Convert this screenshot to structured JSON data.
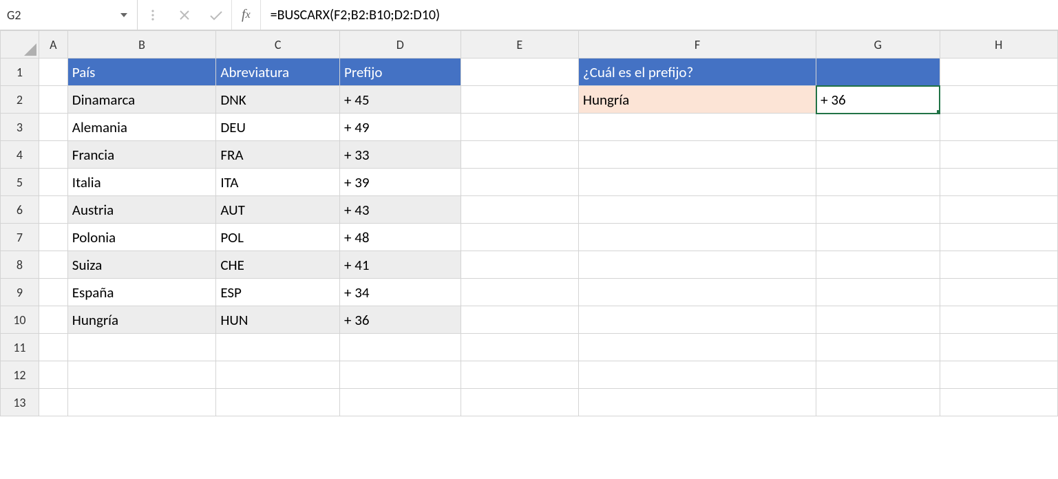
{
  "nameBox": "G2",
  "formula": "=BUSCARX(F2;B2:B10;D2:D10)",
  "fxLabel": "fx",
  "columns": [
    "A",
    "B",
    "C",
    "D",
    "E",
    "F",
    "G",
    "H"
  ],
  "rows": [
    "1",
    "2",
    "3",
    "4",
    "5",
    "6",
    "7",
    "8",
    "9",
    "10",
    "11",
    "12",
    "13"
  ],
  "headers": {
    "pais": "País",
    "abrev": "Abreviatura",
    "prefijo": "Prefijo",
    "pregunta": "¿Cuál es el prefijo?"
  },
  "data": [
    {
      "pais": "Dinamarca",
      "abrev": "DNK",
      "prefijo": "+  45"
    },
    {
      "pais": "Alemania",
      "abrev": "DEU",
      "prefijo": "+  49"
    },
    {
      "pais": "Francia",
      "abrev": "FRA",
      "prefijo": "+  33"
    },
    {
      "pais": "Italia",
      "abrev": "ITA",
      "prefijo": "+  39"
    },
    {
      "pais": "Austria",
      "abrev": "AUT",
      "prefijo": "+  43"
    },
    {
      "pais": "Polonia",
      "abrev": "POL",
      "prefijo": "+  48"
    },
    {
      "pais": "Suiza",
      "abrev": "CHE",
      "prefijo": "+  41"
    },
    {
      "pais": "España",
      "abrev": "ESP",
      "prefijo": "+  34"
    },
    {
      "pais": "Hungría",
      "abrev": "HUN",
      "prefijo": "+  36"
    }
  ],
  "lookup": {
    "input": "Hungría",
    "result": "+  36"
  }
}
